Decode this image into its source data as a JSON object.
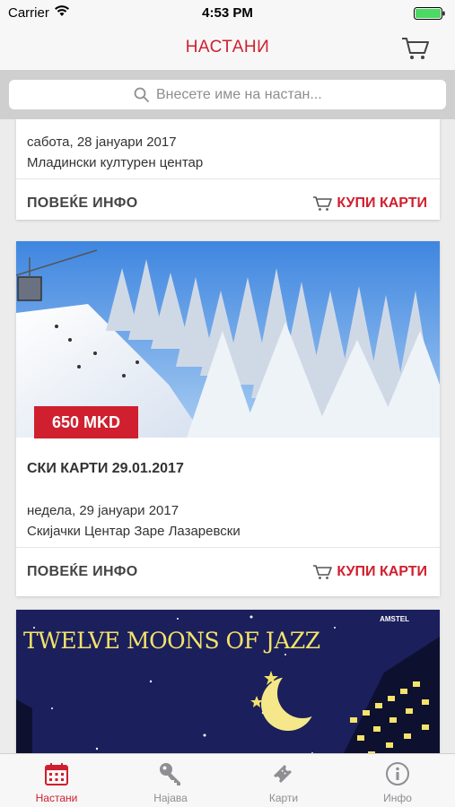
{
  "status": {
    "carrier": "Carrier",
    "time": "4:53 PM"
  },
  "nav": {
    "title": "НАСТАНИ"
  },
  "search": {
    "placeholder": "Внесете име на настан..."
  },
  "events": [
    {
      "date": "сабота, 28 јануари 2017",
      "venue": "Младински културен центар",
      "more_label": "ПОВЕЌЕ ИНФО",
      "buy_label": "КУПИ КАРТИ"
    },
    {
      "price": "650 MKD",
      "title": "СКИ КАРТИ 29.01.2017",
      "date": "недела, 29 јануари 2017",
      "venue": "Скијачки Центар Заре Лазаревски",
      "more_label": "ПОВЕЌЕ ИНФО",
      "buy_label": "КУПИ КАРТИ"
    },
    {
      "banner_text": "TWELVE MOONS OF JAZZ",
      "sponsor_text": "AMSTEL"
    }
  ],
  "tabs": [
    {
      "label": "Настани",
      "icon": "calendar-icon",
      "active": true
    },
    {
      "label": "Најава",
      "icon": "key-icon",
      "active": false
    },
    {
      "label": "Карти",
      "icon": "ticket-icon",
      "active": false
    },
    {
      "label": "Инфо",
      "icon": "info-icon",
      "active": false
    }
  ],
  "colors": {
    "accent": "#d01f2e",
    "inactive": "#8e8e93",
    "battery": "#4cd964"
  }
}
